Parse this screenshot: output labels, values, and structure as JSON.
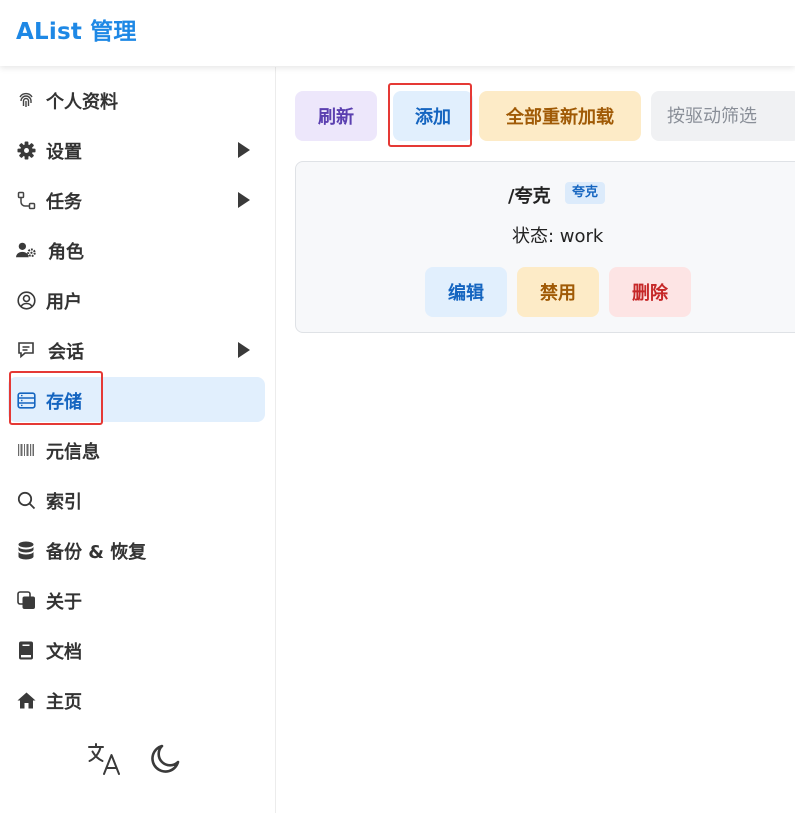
{
  "header": {
    "title": "AList 管理"
  },
  "sidebar": {
    "items": [
      {
        "label": "个人资料",
        "icon": "fingerprint-icon",
        "has_arrow": false,
        "active": false
      },
      {
        "label": "设置",
        "icon": "gear-icon",
        "has_arrow": true,
        "active": false
      },
      {
        "label": "任务",
        "icon": "workflow-icon",
        "has_arrow": true,
        "active": false
      },
      {
        "label": "角色",
        "icon": "user-cog-icon",
        "has_arrow": false,
        "active": false
      },
      {
        "label": "用户",
        "icon": "user-circle-icon",
        "has_arrow": false,
        "active": false
      },
      {
        "label": "会话",
        "icon": "message-icon",
        "has_arrow": true,
        "active": false
      },
      {
        "label": "存储",
        "icon": "storage-icon",
        "has_arrow": false,
        "active": true
      },
      {
        "label": "元信息",
        "icon": "barcode-icon",
        "has_arrow": false,
        "active": false
      },
      {
        "label": "索引",
        "icon": "search-icon",
        "has_arrow": false,
        "active": false
      },
      {
        "label": "备份 & 恢复",
        "icon": "database-icon",
        "has_arrow": false,
        "active": false
      },
      {
        "label": "关于",
        "icon": "copy-icon",
        "has_arrow": false,
        "active": false
      },
      {
        "label": "文档",
        "icon": "book-icon",
        "has_arrow": false,
        "active": false
      },
      {
        "label": "主页",
        "icon": "home-icon",
        "has_arrow": false,
        "active": false
      }
    ],
    "bottom_icons": [
      "translate-icon",
      "moon-icon"
    ]
  },
  "toolbar": {
    "refresh_label": "刷新",
    "add_label": "添加",
    "reload_all_label": "全部重新加载",
    "filter_placeholder": "按驱动筛选"
  },
  "storage_card": {
    "mount_path": "/夸克",
    "driver_badge": "夸克",
    "status": "状态: work",
    "edit_label": "编辑",
    "disable_label": "禁用",
    "delete_label": "删除"
  },
  "colors": {
    "brand": "#1e88e5",
    "active_bg": "#e1effd",
    "highlight_box": "#e53935"
  }
}
